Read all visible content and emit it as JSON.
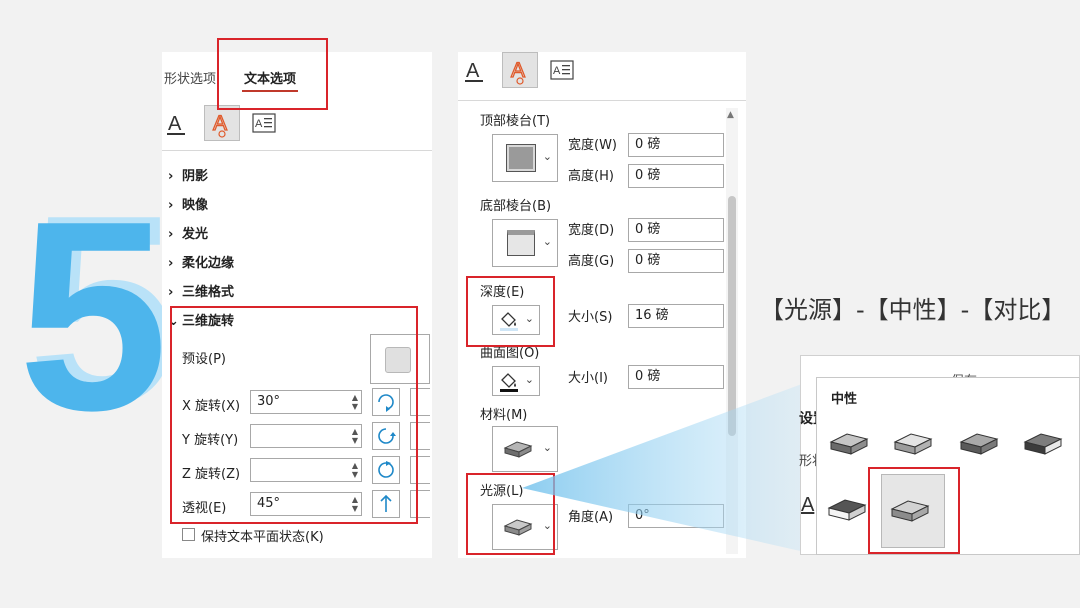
{
  "step_number": "5",
  "callout_text": "【光源】-【中性】-【对比】",
  "left_panel": {
    "tabs": [
      "形状选项",
      "文本选项"
    ],
    "active_tab": "文本选项",
    "sections": [
      "阴影",
      "映像",
      "发光",
      "柔化边缘",
      "三维格式",
      "三维旋转"
    ],
    "rotation": {
      "preset_label": "预设(P)",
      "x_label": "X 旋转(X)",
      "x_value": "30°",
      "y_label": "Y 旋转(Y)",
      "y_value": "",
      "z_label": "Z 旋转(Z)",
      "z_value": "",
      "perspective_label": "透视(E)",
      "perspective_value": "45°"
    },
    "keep_flat_label": "保持文本平面状态(K)"
  },
  "middle_panel": {
    "top_bevel_label": "顶部棱台(T)",
    "width_w_label": "宽度(W)",
    "width_w_value": "0 磅",
    "height_h_label": "高度(H)",
    "height_h_value": "0 磅",
    "bottom_bevel_label": "底部棱台(B)",
    "width_d_label": "宽度(D)",
    "width_d_value": "0 磅",
    "height_g_label": "高度(G)",
    "height_g_value": "0 磅",
    "depth_label": "深度(E)",
    "size_s_label": "大小(S)",
    "size_s_value": "16 磅",
    "contour_label": "曲面图(O)",
    "size_i_label": "大小(I)",
    "size_i_value": "0 磅",
    "material_label": "材料(M)",
    "light_label": "光源(L)",
    "angle_label": "角度(A)",
    "angle_value": "0°"
  },
  "gallery": {
    "title": "中性",
    "bg_fragments": [
      "保存",
      "设置",
      "形状"
    ]
  },
  "colors": {
    "accent_red": "#d9242a",
    "five_blue": "#4db5ec",
    "icon_orange": "#e05a2b"
  }
}
